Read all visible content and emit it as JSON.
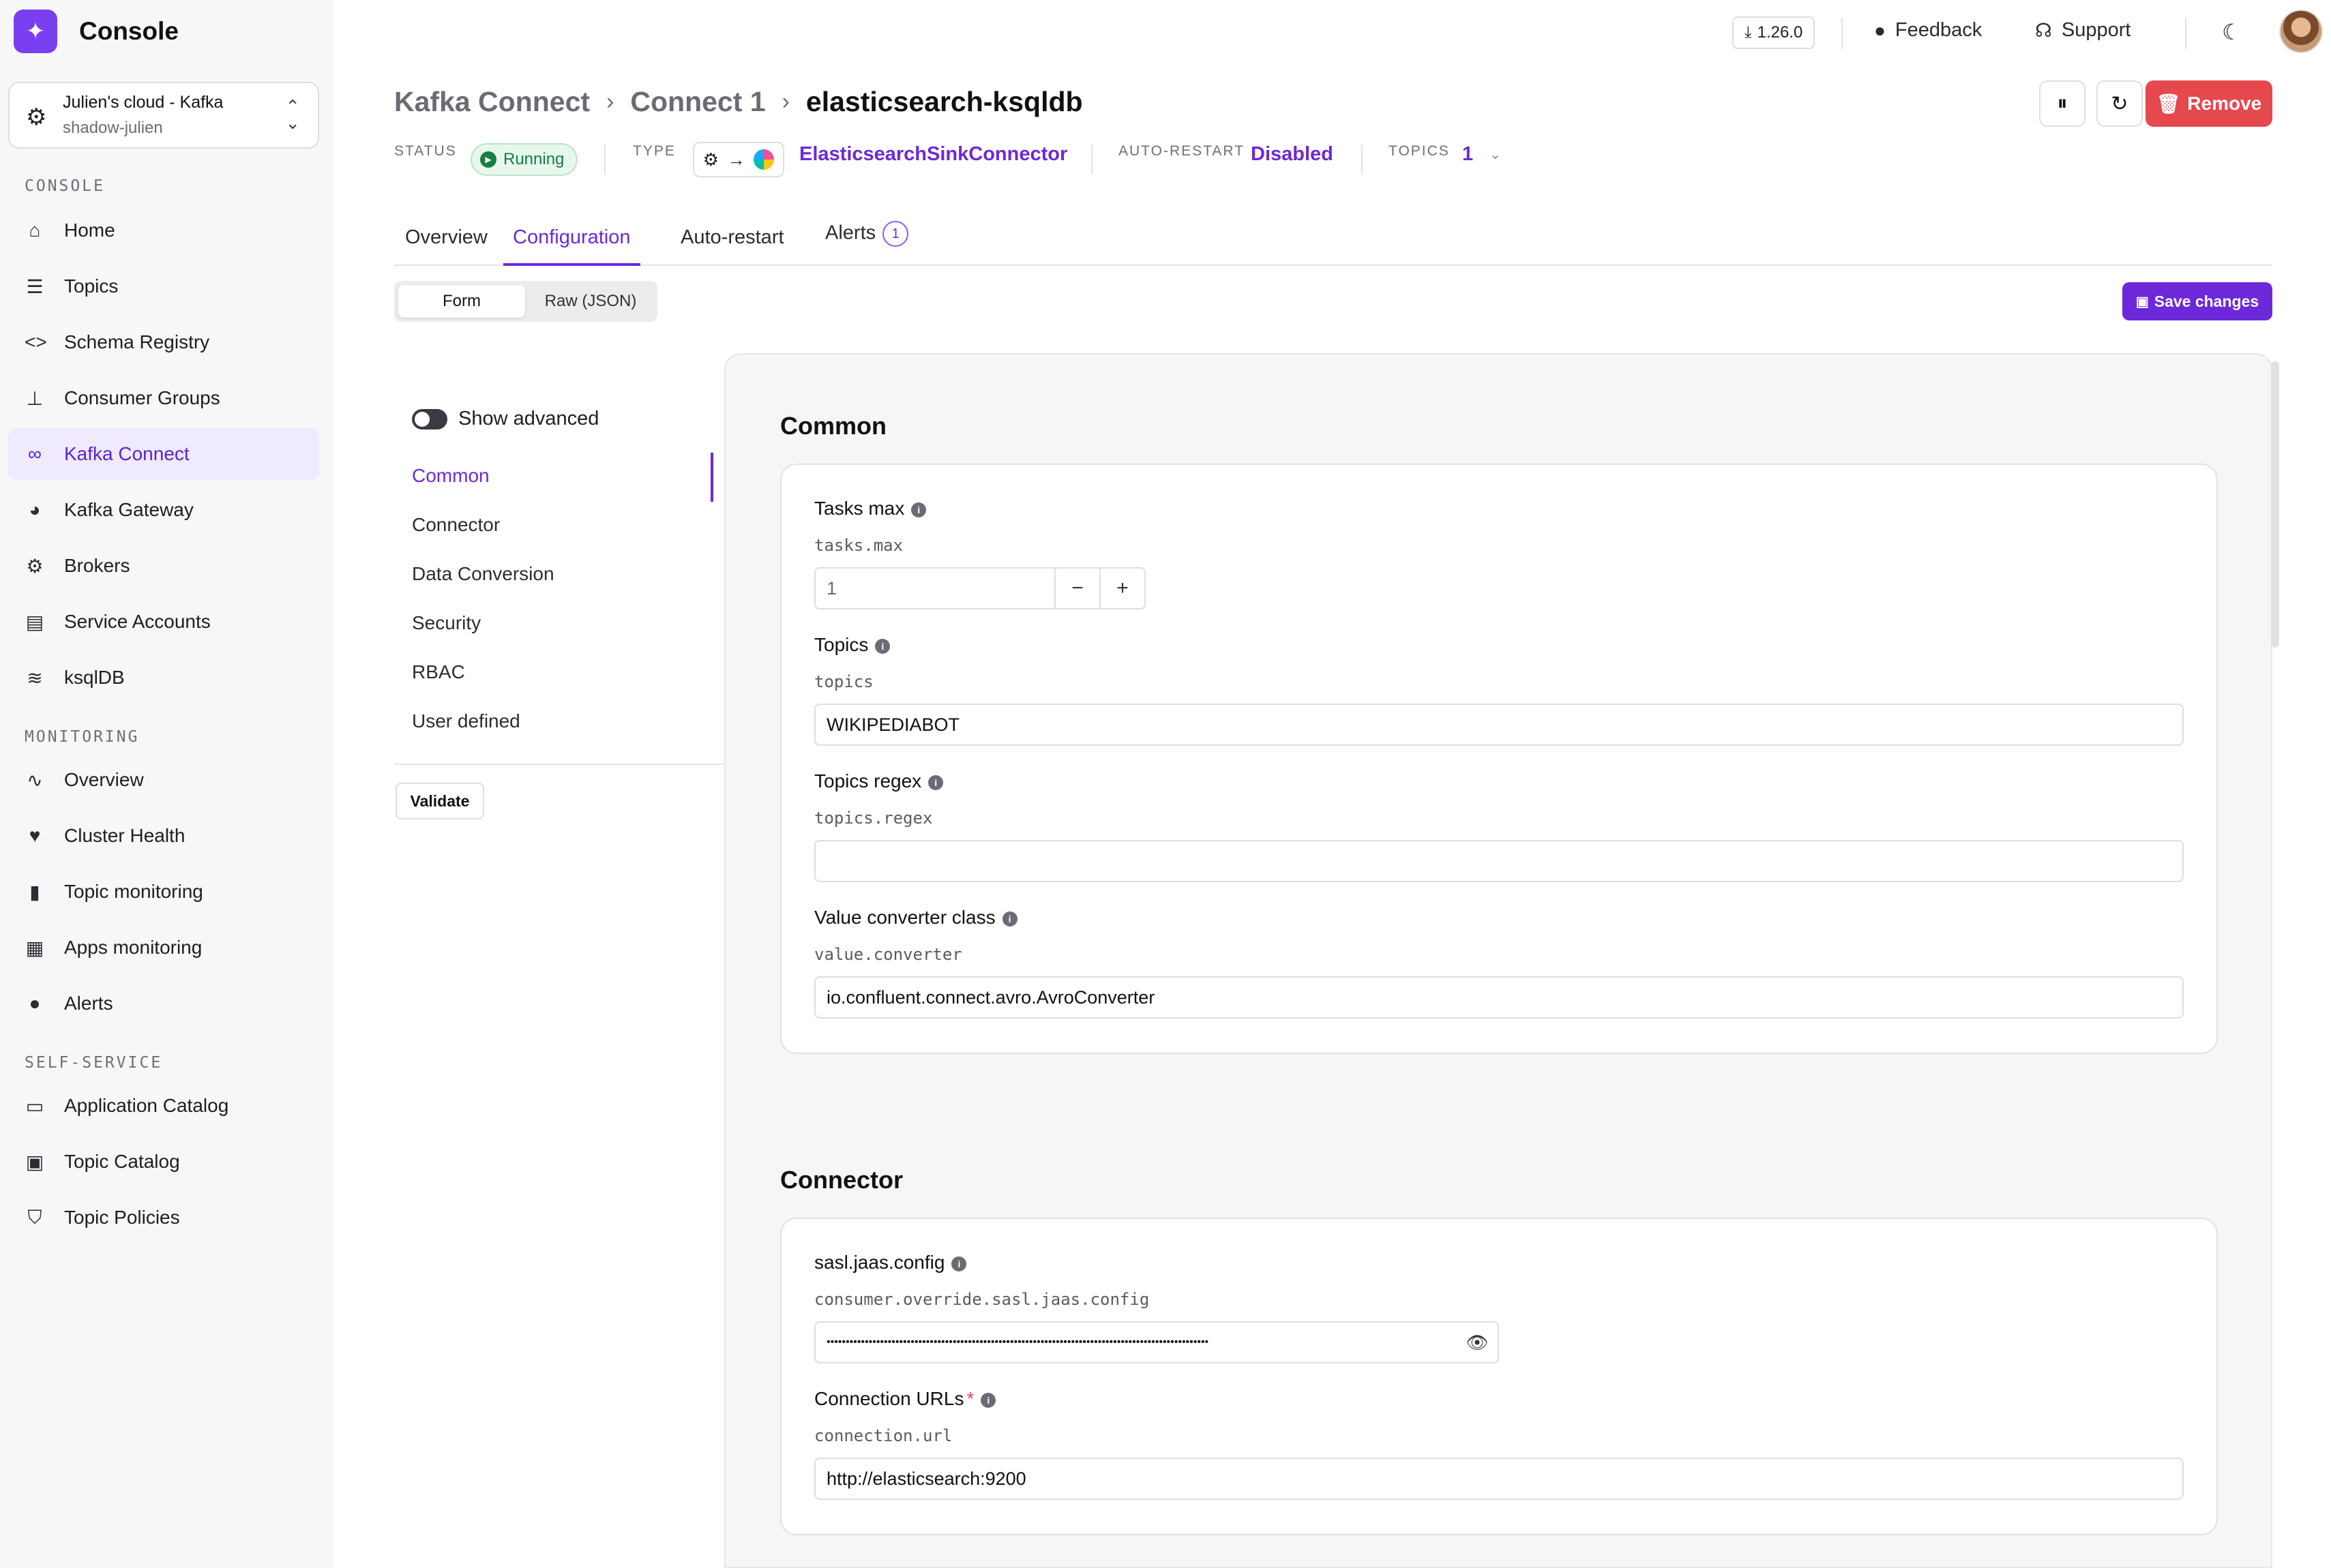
{
  "app": {
    "title": "Console"
  },
  "cluster": {
    "name": "Julien's cloud - Kafka",
    "sub": "shadow-julien"
  },
  "sidebar": {
    "sections": [
      {
        "label": "CONSOLE",
        "items": [
          {
            "label": "Home",
            "icon": "home-icon"
          },
          {
            "label": "Topics",
            "icon": "topics-icon"
          },
          {
            "label": "Schema Registry",
            "icon": "code-icon"
          },
          {
            "label": "Consumer Groups",
            "icon": "hierarchy-icon"
          },
          {
            "label": "Kafka Connect",
            "icon": "link-icon",
            "active": true
          },
          {
            "label": "Kafka Gateway",
            "icon": "gateway-icon"
          },
          {
            "label": "Brokers",
            "icon": "chip-icon"
          },
          {
            "label": "Service Accounts",
            "icon": "user-file-icon"
          },
          {
            "label": "ksqlDB",
            "icon": "database-icon"
          }
        ]
      },
      {
        "label": "MONITORING",
        "items": [
          {
            "label": "Overview",
            "icon": "pulse-icon"
          },
          {
            "label": "Cluster Health",
            "icon": "heart-icon"
          },
          {
            "label": "Topic monitoring",
            "icon": "bar-chart-icon"
          },
          {
            "label": "Apps monitoring",
            "icon": "apps-icon"
          },
          {
            "label": "Alerts",
            "icon": "alert-icon"
          }
        ]
      },
      {
        "label": "SELF-SERVICE",
        "items": [
          {
            "label": "Application Catalog",
            "icon": "window-icon"
          },
          {
            "label": "Topic Catalog",
            "icon": "catalog-icon"
          },
          {
            "label": "Topic Policies",
            "icon": "shield-icon"
          }
        ]
      }
    ]
  },
  "header": {
    "version": "1.26.0",
    "feedback": "Feedback",
    "support": "Support"
  },
  "breadcrumb": {
    "root": "Kafka Connect",
    "cluster": "Connect 1",
    "current": "elasticsearch-ksqldb"
  },
  "actions": {
    "remove": "Remove"
  },
  "meta": {
    "status_label": "STATUS",
    "status_value": "Running",
    "type_label": "TYPE",
    "type_value": "ElasticsearchSinkConnector",
    "autorestart_label": "AUTO-RESTART",
    "autorestart_value": "Disabled",
    "topics_label": "TOPICS",
    "topics_value": "1"
  },
  "tabs": {
    "overview": "Overview",
    "configuration": "Configuration",
    "autorestart": "Auto-restart",
    "alerts": "Alerts",
    "alerts_count": "1"
  },
  "mode": {
    "form": "Form",
    "raw": "Raw (JSON)"
  },
  "save": "Save changes",
  "config_nav": {
    "show_advanced": "Show advanced",
    "items": [
      "Common",
      "Connector",
      "Data Conversion",
      "Security",
      "RBAC",
      "User defined"
    ],
    "validate": "Validate"
  },
  "common": {
    "title": "Common",
    "tasks_max": {
      "label": "Tasks max",
      "key": "tasks.max",
      "value": "1"
    },
    "topics": {
      "label": "Topics",
      "key": "topics",
      "value": "WIKIPEDIABOT"
    },
    "topics_regex": {
      "label": "Topics regex",
      "key": "topics.regex",
      "value": ""
    },
    "value_converter": {
      "label": "Value converter class",
      "key": "value.converter",
      "value": "io.confluent.connect.avro.AvroConverter"
    }
  },
  "connector": {
    "title": "Connector",
    "sasl": {
      "label": "sasl.jaas.config",
      "key": "consumer.override.sasl.jaas.config",
      "value": "••••••••••••••••••••••••••••••••••••••••••••••••••••••••••••••••••••••••••••••••••••••••••••••••••••"
    },
    "conn_urls": {
      "label": "Connection URLs",
      "key": "connection.url",
      "value": "http://elasticsearch:9200"
    }
  }
}
